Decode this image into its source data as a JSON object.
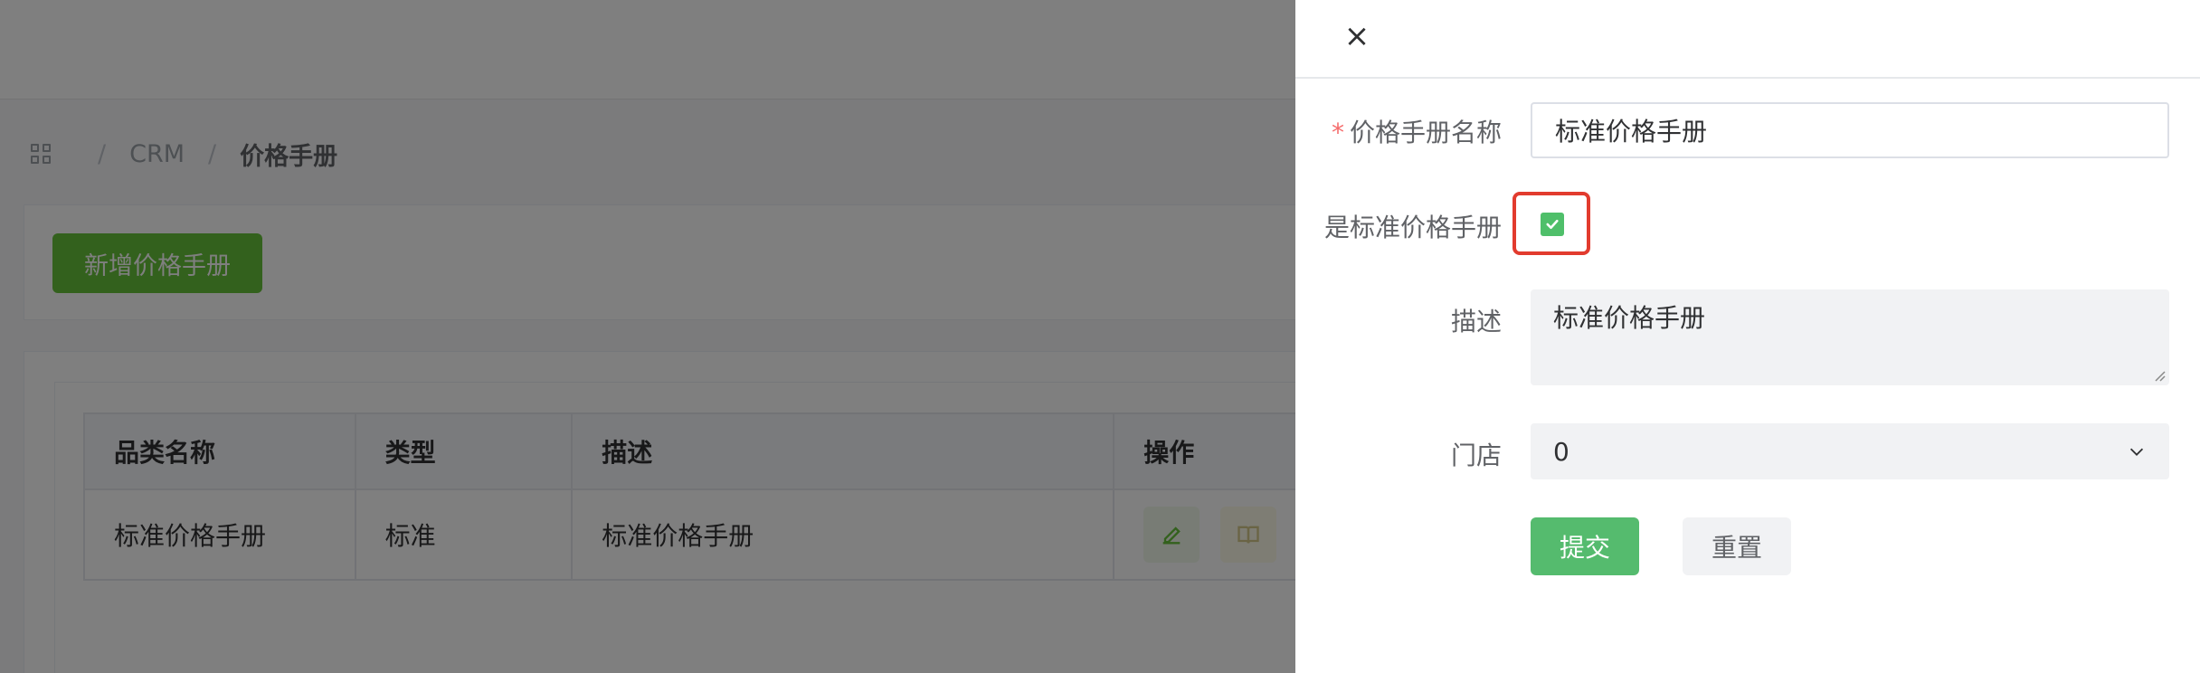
{
  "background": {
    "breadcrumb": {
      "items": [
        "CRM",
        "价格手册"
      ],
      "separator": "/"
    },
    "toolbar": {
      "add_label": "新增价格手册"
    },
    "table": {
      "headers": [
        "品类名称",
        "类型",
        "描述",
        "操作"
      ],
      "rows": [
        {
          "name": "标准价格手册",
          "type": "标准",
          "description": "标准价格手册"
        }
      ]
    }
  },
  "drawer": {
    "close_symbol": "×",
    "form": {
      "name_label": "价格手册名称",
      "required_mark": "*",
      "name_value": "标准价格手册",
      "standard_label": "是标准价格手册",
      "standard_checked": true,
      "description_label": "描述",
      "description_value": "标准价格手册",
      "store_label": "门店",
      "store_value": "0",
      "submit_label": "提交",
      "reset_label": "重置"
    }
  },
  "colors": {
    "primary_green": "#55bb6e",
    "checkbox_green": "#4fbf6a",
    "highlight_red": "#e23b2e",
    "required_red": "#f56c6c"
  }
}
